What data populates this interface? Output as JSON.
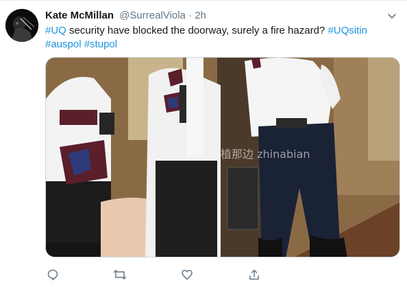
{
  "tweet": {
    "author_name": "Kate McMillan",
    "author_handle": "@SurrealViola",
    "separator": "·",
    "timestamp": "2h",
    "text_segments": [
      {
        "text": "#UQ",
        "hashtag": true
      },
      {
        "text": " security have blocked the doorway, surely a fire hazard? ",
        "hashtag": false
      },
      {
        "text": "#UQsitin",
        "hashtag": true
      },
      {
        "text": " ",
        "hashtag": false
      },
      {
        "text": "#auspol",
        "hashtag": true
      },
      {
        "text": " ",
        "hashtag": false
      },
      {
        "text": "#stupol",
        "hashtag": true
      }
    ],
    "watermark": "植那边 zhinabian"
  },
  "actions": [
    {
      "name": "reply-icon"
    },
    {
      "name": "retweet-icon"
    },
    {
      "name": "like-icon"
    },
    {
      "name": "share-icon"
    }
  ],
  "colors": {
    "hashtag": "#1b95e0",
    "secondary_text": "#657786",
    "primary_text": "#14171a"
  }
}
